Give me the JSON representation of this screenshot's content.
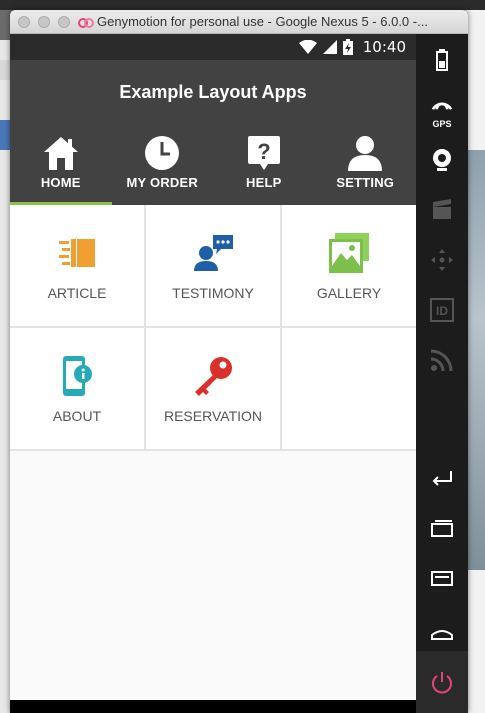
{
  "window": {
    "title": "Genymotion for personal use - Google Nexus 5 - 6.0.0 -..."
  },
  "statusbar": {
    "time": "10:40"
  },
  "appbar": {
    "title": "Example Layout Apps"
  },
  "tabs": [
    {
      "label": "HOME",
      "icon": "home-icon",
      "active": true
    },
    {
      "label": "MY ORDER",
      "icon": "clock-icon",
      "active": false
    },
    {
      "label": "HELP",
      "icon": "help-icon",
      "active": false
    },
    {
      "label": "SETTING",
      "icon": "user-icon",
      "active": false
    }
  ],
  "menu": [
    {
      "label": "ARTICLE",
      "icon": "article-icon",
      "color": "#f0a030"
    },
    {
      "label": "TESTIMONY",
      "icon": "testimony-icon",
      "color": "#1e5fa8"
    },
    {
      "label": "GALLERY",
      "icon": "gallery-icon",
      "color": "#7cc04b"
    },
    {
      "label": "ABOUT",
      "icon": "about-icon",
      "color": "#26a9b8"
    },
    {
      "label": "RESERVATION",
      "icon": "key-icon",
      "color": "#d9302c"
    }
  ],
  "sidebar": {
    "gps_label": "GPS",
    "id_label": "ID"
  },
  "colors": {
    "appbar": "#424242",
    "active_tab_indicator": "#8bc34a",
    "power": "#e2457a"
  }
}
